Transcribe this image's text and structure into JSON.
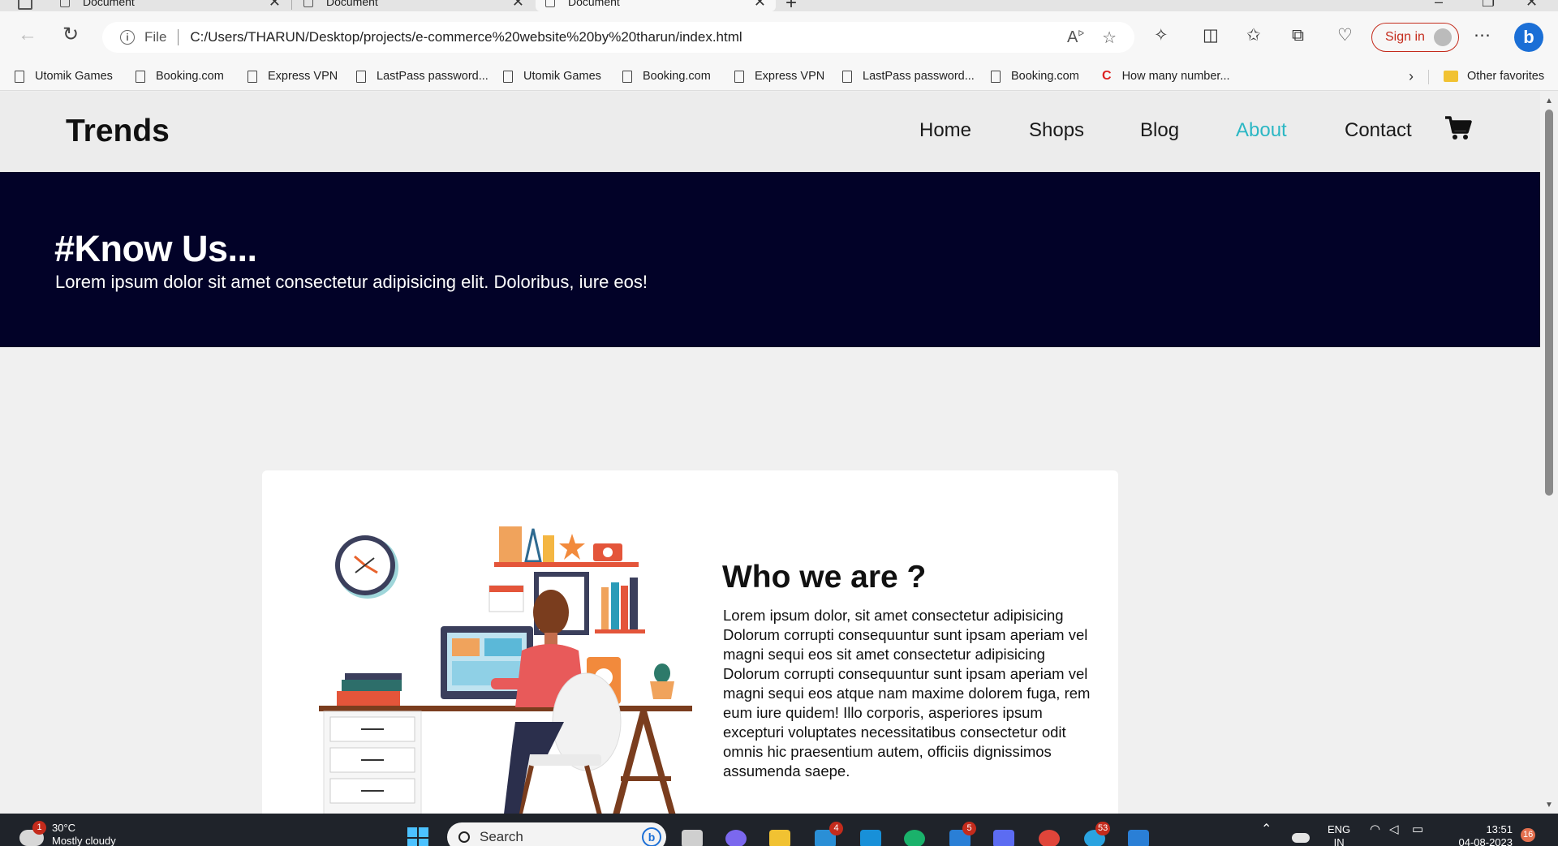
{
  "browser": {
    "tabs": [
      {
        "label": "Document",
        "active": false
      },
      {
        "label": "Document",
        "active": false
      },
      {
        "label": "Document",
        "active": true
      }
    ],
    "address": {
      "scheme_label": "File",
      "url": "C:/Users/THARUN/Desktop/projects/e-commerce%20website%20by%20tharun/index.html"
    },
    "sign_in_label": "Sign in",
    "bookmarks": [
      "Utomik Games",
      "Booking.com",
      "Express VPN",
      "LastPass password...",
      "Utomik Games",
      "Booking.com",
      "Express VPN",
      "LastPass password...",
      "Booking.com",
      "How many number..."
    ],
    "other_favorites": "Other favorites"
  },
  "site": {
    "logo": "Trends",
    "nav": [
      "Home",
      "Shops",
      "Blog",
      "About",
      "Contact"
    ],
    "active_nav": "About",
    "accent_color": "#2bb7c4",
    "hero": {
      "title": "#Know Us...",
      "subtitle": "Lorem ipsum dolor sit amet consectetur adipisicing elit. Doloribus, iure eos!",
      "bg_color": "#020228"
    },
    "about": {
      "heading": "Who we are ?",
      "body": "Lorem ipsum dolor, sit amet consectetur adipisicing Dolorum corrupti consequuntur sunt ipsam aperiam vel magni sequi eos sit amet consectetur adipisicing Dolorum corrupti consequuntur sunt ipsam aperiam vel magni sequi eos atque nam maxime dolorem fuga, rem eum iure quidem! Illo corporis, asperiores ipsum excepturi voluptates necessitatibus consectetur odit omnis hic praesentium autem, officiis dignissimos assumenda saepe."
    }
  },
  "taskbar": {
    "weather_badge": "1",
    "temperature": "30°C",
    "condition": "Mostly cloudy",
    "search_placeholder": "Search",
    "mail_badge": "4",
    "store_badge": "5",
    "telegram_badge": "53",
    "language": "ENG",
    "region": "IN",
    "time": "13:51",
    "date": "04-08-2023",
    "notification_count": "16"
  }
}
